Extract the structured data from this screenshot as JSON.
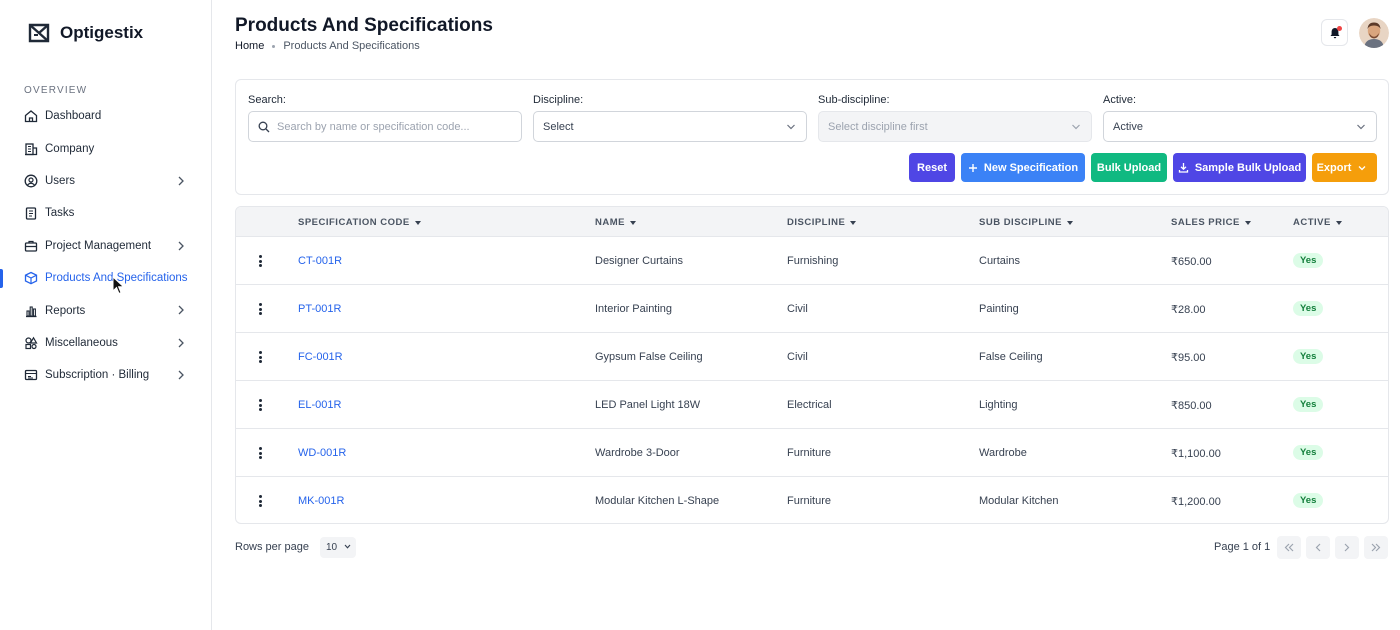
{
  "app": {
    "name": "Optigestix"
  },
  "sidebar": {
    "section": "OVERVIEW",
    "items": [
      {
        "label": "Dashboard",
        "icon": "home-icon"
      },
      {
        "label": "Company",
        "icon": "building-icon"
      },
      {
        "label": "Users",
        "icon": "user-circle-icon",
        "expandable": true
      },
      {
        "label": "Tasks",
        "icon": "clipboard-icon"
      },
      {
        "label": "Project Management",
        "icon": "briefcase-icon",
        "expandable": true
      },
      {
        "label": "Products And Specifications",
        "icon": "box-icon",
        "active": true
      },
      {
        "label": "Reports",
        "icon": "bar-chart-icon",
        "expandable": true
      },
      {
        "label": "Miscellaneous",
        "icon": "shapes-icon",
        "expandable": true
      },
      {
        "label": "Subscription · Billing",
        "icon": "billing-icon",
        "expandable": true
      }
    ]
  },
  "header": {
    "title": "Products And Specifications",
    "breadcrumb": [
      "Home",
      "Products And Specifications"
    ]
  },
  "filters": {
    "search": {
      "label": "Search:",
      "placeholder": "Search by name or specification code...",
      "value": ""
    },
    "discipline": {
      "label": "Discipline:",
      "value": "Select"
    },
    "sub_discipline": {
      "label": "Sub-discipline:",
      "value": "Select discipline first",
      "disabled": true
    },
    "active": {
      "label": "Active:",
      "value": "Active"
    }
  },
  "actions": {
    "reset": "Reset",
    "new_spec": "New Specification",
    "bulk_upload": "Bulk Upload",
    "sample_bulk_upload": "Sample Bulk Upload",
    "export": "Export"
  },
  "colors": {
    "accent": "#2563eb",
    "reset": "#4f46e5",
    "new_spec": "#3b82f6",
    "bulk_upload": "#10b981",
    "sample_bulk_upload": "#4f46e5",
    "export": "#f59e0b",
    "badge_bg": "#dcfce7",
    "badge_text": "#15803d"
  },
  "table": {
    "columns": [
      "SPECIFICATION CODE",
      "NAME",
      "DISCIPLINE",
      "SUB DISCIPLINE",
      "SALES PRICE",
      "ACTIVE"
    ],
    "rows": [
      {
        "code": "CT-001R",
        "name": "Designer Curtains",
        "discipline": "Furnishing",
        "sub": "Curtains",
        "price": "₹650.00",
        "active": "Yes"
      },
      {
        "code": "PT-001R",
        "name": "Interior Painting",
        "discipline": "Civil",
        "sub": "Painting",
        "price": "₹28.00",
        "active": "Yes"
      },
      {
        "code": "FC-001R",
        "name": "Gypsum False Ceiling",
        "discipline": "Civil",
        "sub": "False Ceiling",
        "price": "₹95.00",
        "active": "Yes"
      },
      {
        "code": "EL-001R",
        "name": "LED Panel Light 18W",
        "discipline": "Electrical",
        "sub": "Lighting",
        "price": "₹850.00",
        "active": "Yes"
      },
      {
        "code": "WD-001R",
        "name": "Wardrobe 3-Door",
        "discipline": "Furniture",
        "sub": "Wardrobe",
        "price": "₹1,100.00",
        "active": "Yes"
      },
      {
        "code": "MK-001R",
        "name": "Modular Kitchen L-Shape",
        "discipline": "Furniture",
        "sub": "Modular Kitchen",
        "price": "₹1,200.00",
        "active": "Yes"
      }
    ]
  },
  "pagination": {
    "rows_per_page_label": "Rows per page",
    "rows_per_page": "10",
    "page_info": "Page 1 of 1"
  }
}
